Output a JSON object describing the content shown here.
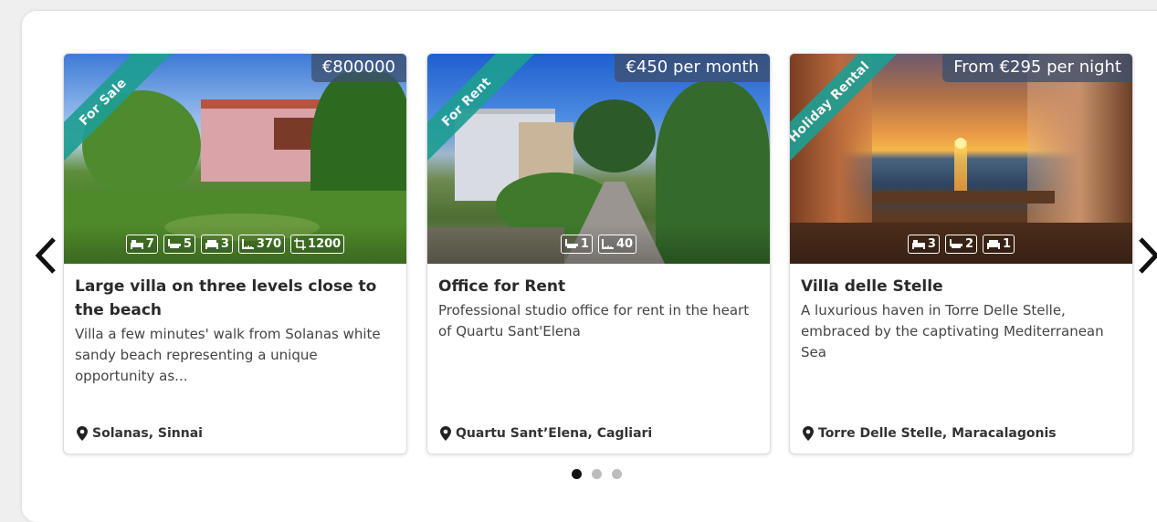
{
  "carousel": {
    "prev_label": "Previous",
    "next_label": "Next",
    "pagination": {
      "total": 3,
      "active_index": 0
    },
    "cards": [
      {
        "tag": "For Sale",
        "price": "€800000",
        "features": [
          {
            "icon": "bed-icon",
            "value": "7"
          },
          {
            "icon": "bath-icon",
            "value": "5"
          },
          {
            "icon": "sofa-icon",
            "value": "3"
          },
          {
            "icon": "area-icon",
            "value": "370"
          },
          {
            "icon": "land-icon",
            "value": "1200"
          }
        ],
        "title": "Large villa on three levels close to the beach",
        "description": "Villa a few minutes' walk from Solanas white sandy beach representing a unique opportunity as...",
        "location": "Solanas, Sinnai"
      },
      {
        "tag": "For Rent",
        "price": "€450 per month",
        "features": [
          {
            "icon": "bath-icon",
            "value": "1"
          },
          {
            "icon": "area-icon",
            "value": "40"
          }
        ],
        "title": "Office for Rent",
        "description": "Professional studio office for rent in the heart of Quartu Sant'Elena",
        "location": "Quartu Sant’Elena, Cagliari"
      },
      {
        "tag": "Holiday Rental",
        "price": "From €295 per night",
        "features": [
          {
            "icon": "bed-icon",
            "value": "3"
          },
          {
            "icon": "bath-icon",
            "value": "2"
          },
          {
            "icon": "sofa-icon",
            "value": "1"
          }
        ],
        "title": "Villa delle Stelle",
        "description": "A luxurious haven in Torre Delle Stelle, embraced by the captivating Mediterranean Sea",
        "location": "Torre Delle Stelle, Maracalagonis"
      }
    ]
  },
  "colors": {
    "ribbon": "#1f9e93",
    "price_badge": "#3c506e",
    "dot_active": "#111111",
    "dot_inactive": "#bdbdbd"
  }
}
